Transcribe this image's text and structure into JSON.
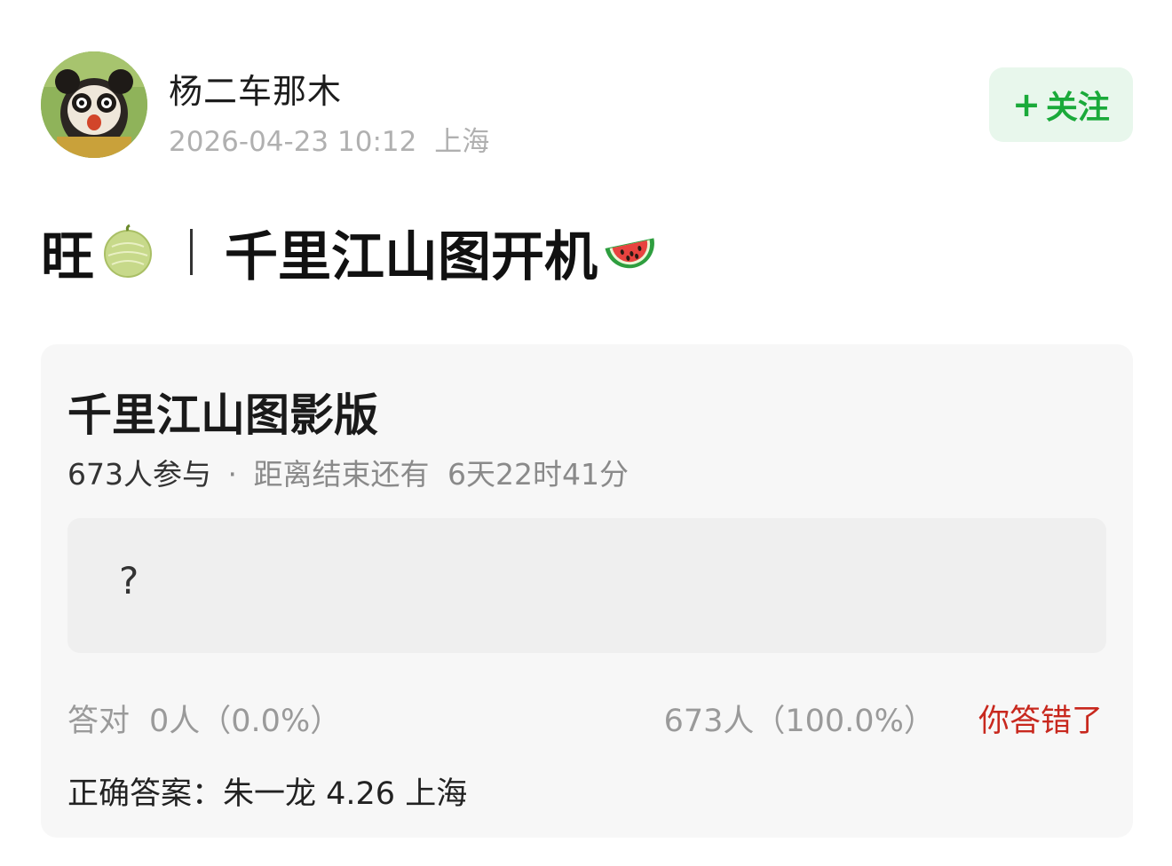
{
  "author": {
    "name": "杨二车那木",
    "date": "2026-04-23 10:12",
    "location": "上海"
  },
  "follow_button": {
    "plus": "+",
    "label": "关注"
  },
  "post": {
    "title_start": "旺",
    "title_end": "千里江山图开机",
    "emoji_left": "melon-icon",
    "emoji_right": "watermelon-icon"
  },
  "quiz": {
    "title": "千里江山图影版",
    "participants": "673人参与",
    "dot": "·",
    "countdown_label": "距离结束还有",
    "countdown": "6天22时41分",
    "option": "?",
    "correct_label": "答对",
    "correct_stat": "0人（0.0%）",
    "wrong_stat": "673人（100.0%）",
    "wrong_status": "你答错了",
    "answer_label": "正确答案：",
    "answer": "朱一龙 4.26 上海"
  },
  "colors": {
    "follow_green": "#1aaa3a",
    "follow_bg": "#e8f7ec",
    "wrong_red": "#c8281e",
    "card_bg": "#f7f7f7"
  }
}
